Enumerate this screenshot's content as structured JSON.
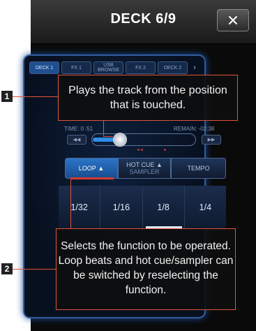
{
  "header": {
    "title": "DECK 6/9",
    "close_icon": "close-icon"
  },
  "tabs": [
    {
      "label": "DECK 1",
      "active": true
    },
    {
      "label": "FX 1"
    },
    {
      "label": "USB BROWSE"
    },
    {
      "label": "FX 2"
    },
    {
      "label": "DECK 2"
    }
  ],
  "tabs_more_icon": "chevron-right-icon",
  "playback": {
    "time_label": "TIME: 0",
    "time_value": ":51",
    "remain_label": "REMAIN: -02:38",
    "rewind_icon": "skip-back-icon",
    "forward_icon": "skip-forward-icon"
  },
  "function_buttons": [
    {
      "label": "LOOP",
      "active": true
    },
    {
      "label": "HOT CUE",
      "sub": "SAMPLER"
    },
    {
      "label": "TEMPO"
    }
  ],
  "pads": [
    "1/32",
    "1/16",
    "1/8",
    "1/4"
  ],
  "callouts": [
    {
      "number": "1",
      "text": "Plays the track from the position that is touched."
    },
    {
      "number": "2",
      "text": "Selects the function to be operated. Loop beats and hot cue/sampler can be switched by reselecting the function."
    }
  ],
  "colors": {
    "accent": "#2c8ee6",
    "callout_border": "#e0553a",
    "header": "#2a2a2a"
  }
}
